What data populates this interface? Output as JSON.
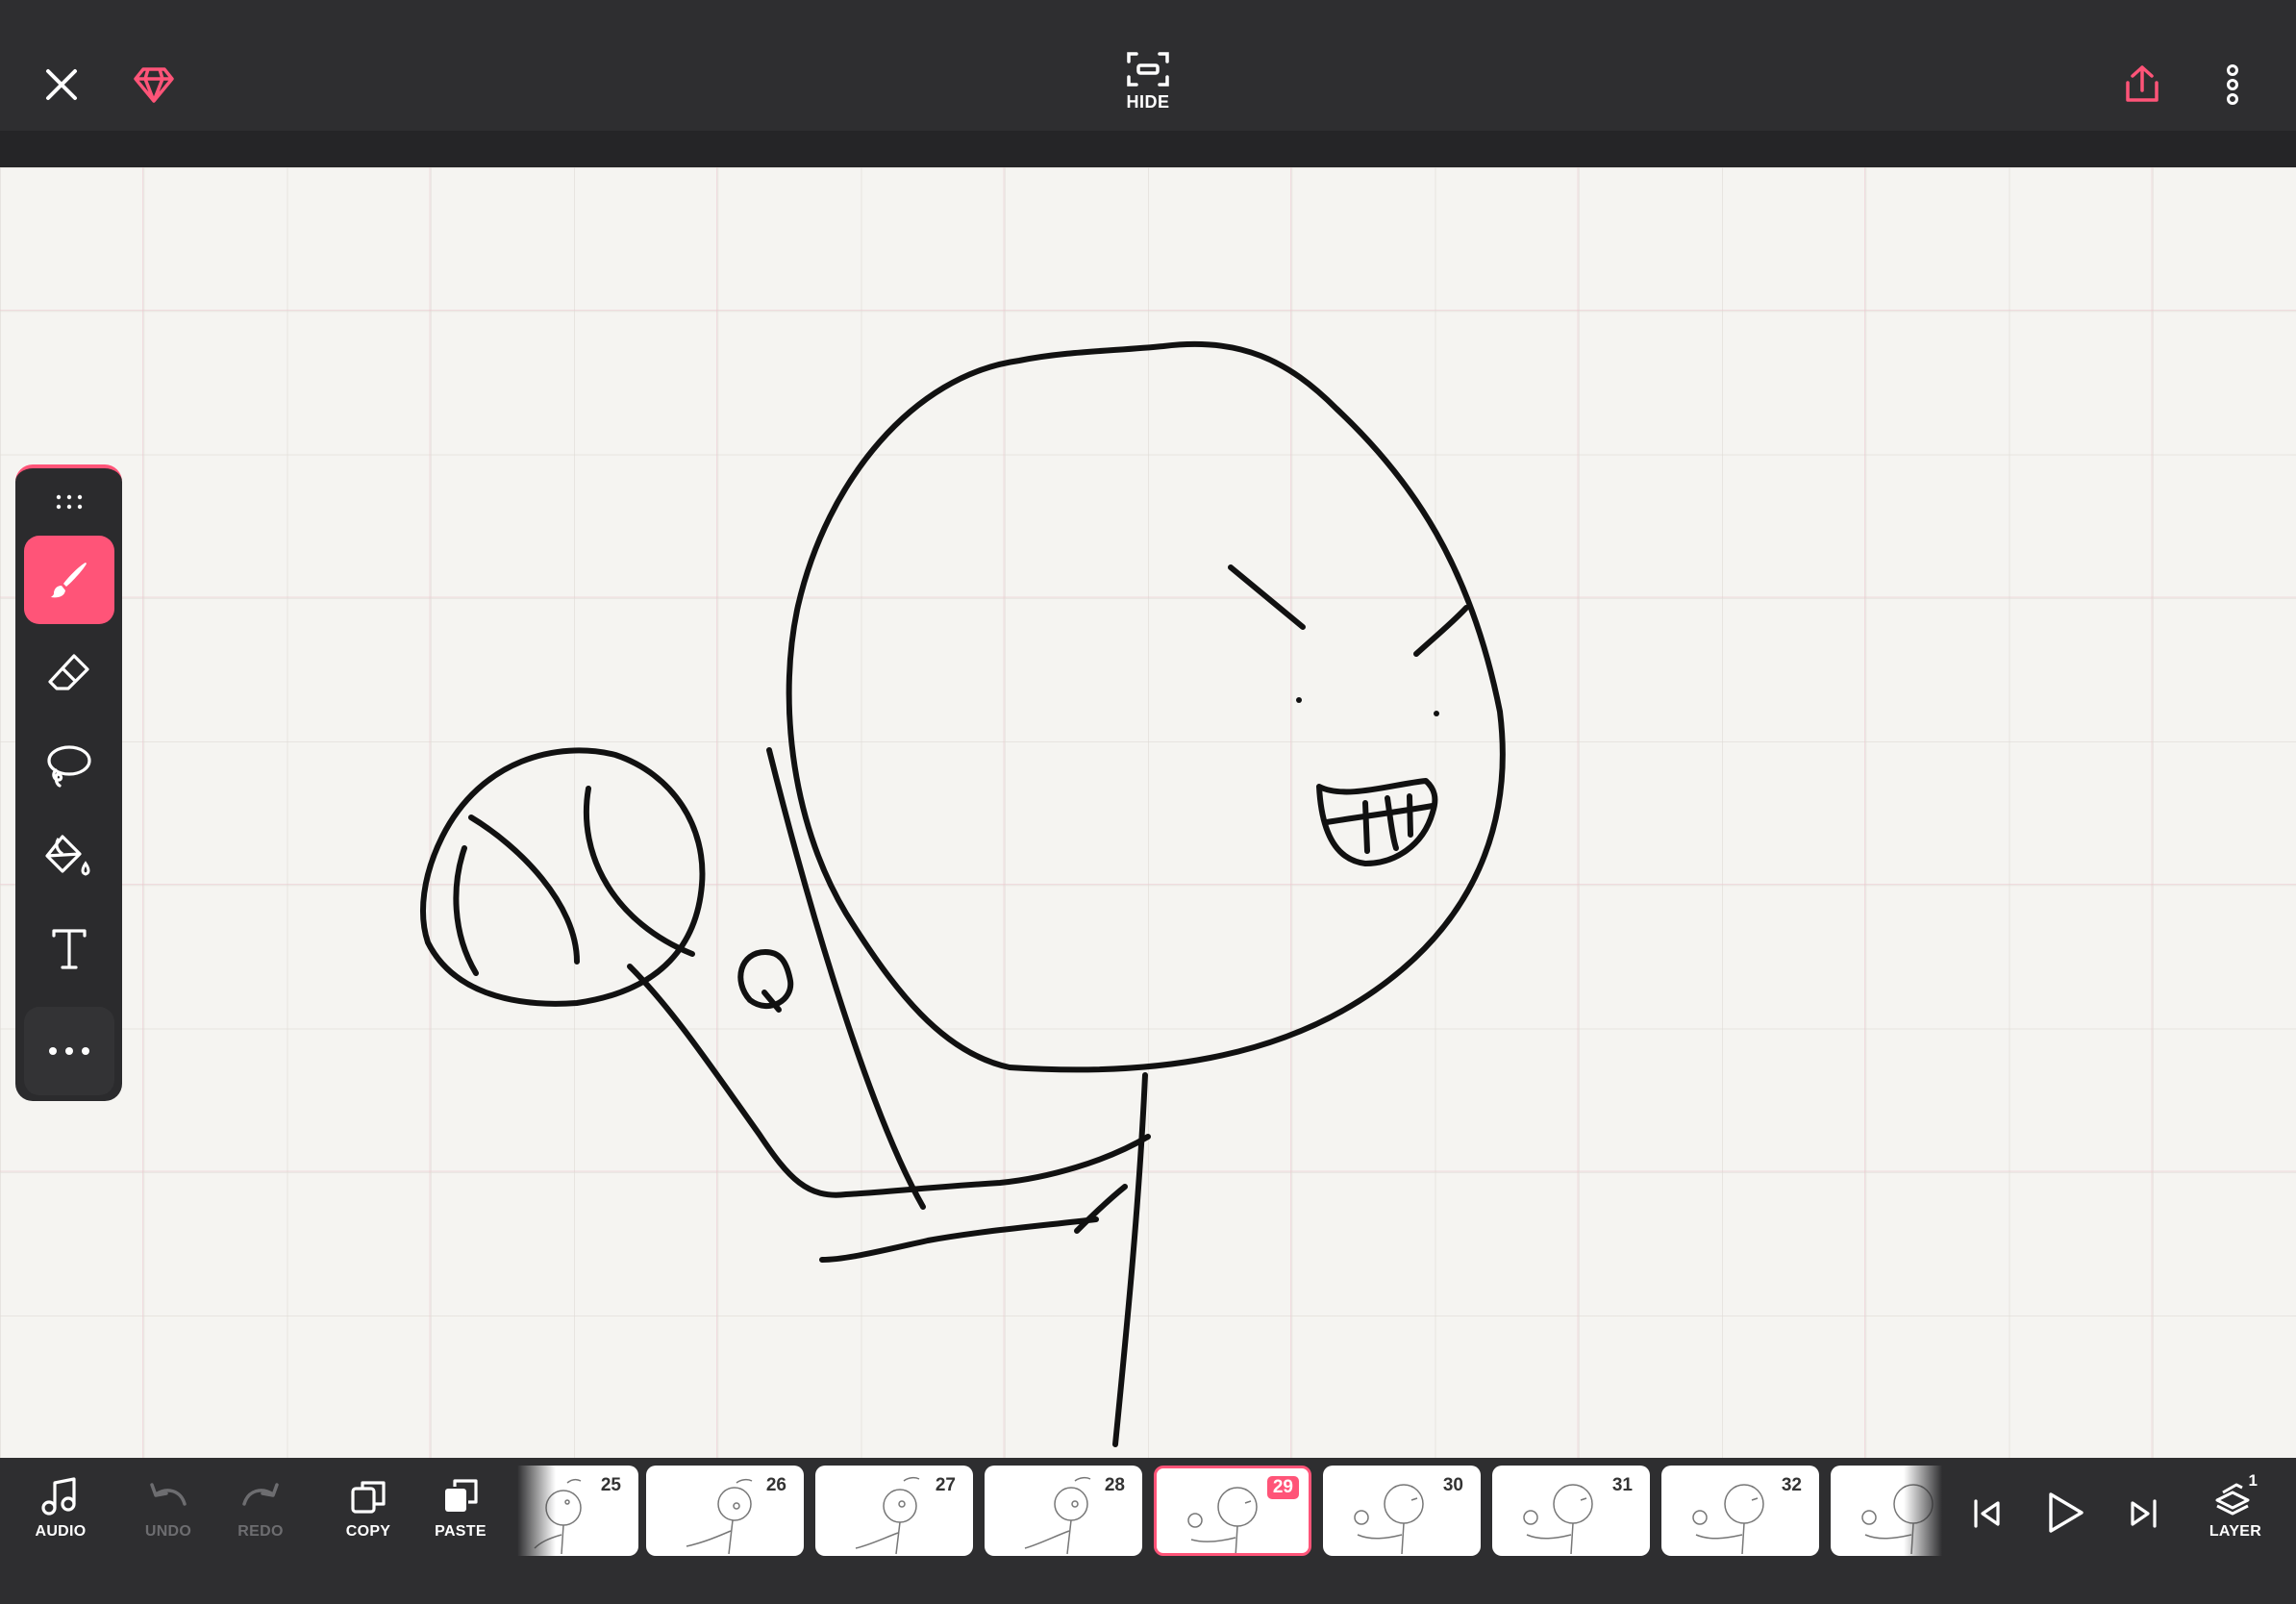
{
  "topbar": {
    "close_icon": "close-icon",
    "premium_icon": "diamond-icon",
    "hide_label": "HIDE",
    "share_icon": "share-icon",
    "menu_icon": "more-vertical-icon"
  },
  "toolbox": {
    "tools": [
      {
        "name": "brush",
        "icon": "brush-icon",
        "active": true
      },
      {
        "name": "eraser",
        "icon": "eraser-icon",
        "active": false
      },
      {
        "name": "lasso",
        "icon": "lasso-icon",
        "active": false
      },
      {
        "name": "fill",
        "icon": "paint-bucket-icon",
        "active": false
      },
      {
        "name": "text",
        "icon": "text-icon",
        "active": false
      }
    ],
    "more_icon": "more-horizontal-icon"
  },
  "bottombar": {
    "audio": "AUDIO",
    "undo": "UNDO",
    "redo": "REDO",
    "copy": "COPY",
    "paste": "PASTE",
    "layer": "LAYER",
    "layer_count": "1",
    "frames": [
      "25",
      "26",
      "27",
      "28",
      "29",
      "30",
      "31",
      "32",
      ""
    ],
    "current_frame": "29"
  },
  "colors": {
    "accent": "#ff5478",
    "bar": "#2e2e30",
    "canvas": "#f5f4f1"
  }
}
